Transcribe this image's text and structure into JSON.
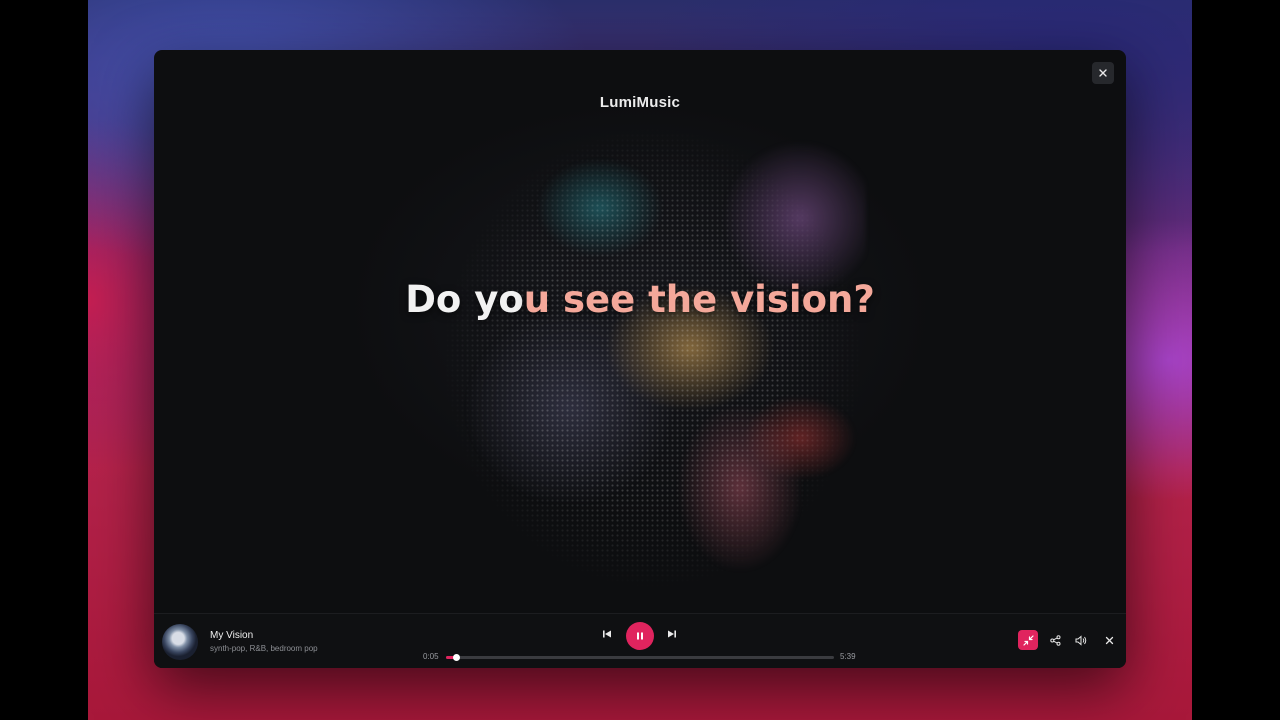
{
  "window": {
    "close_icon": "close-icon"
  },
  "brand": {
    "name": "LumiMusic"
  },
  "lyric": {
    "sung": "Do yo",
    "unsung": "u see the vision?"
  },
  "player": {
    "title": "My Vision",
    "genres": "synth-pop, R&B, bedroom pop",
    "current_time": "0:05",
    "total_time": "5:39",
    "progress": 0.025,
    "state": "playing"
  },
  "colors": {
    "accent": "#e0245e",
    "lyric_upcoming": "#f4a89a"
  },
  "icons": {
    "prev": "skip-previous-icon",
    "play_pause": "pause-icon",
    "next": "skip-next-icon",
    "collapse": "minimize-icon",
    "share": "share-icon",
    "volume": "volume-icon",
    "close": "close-icon"
  }
}
